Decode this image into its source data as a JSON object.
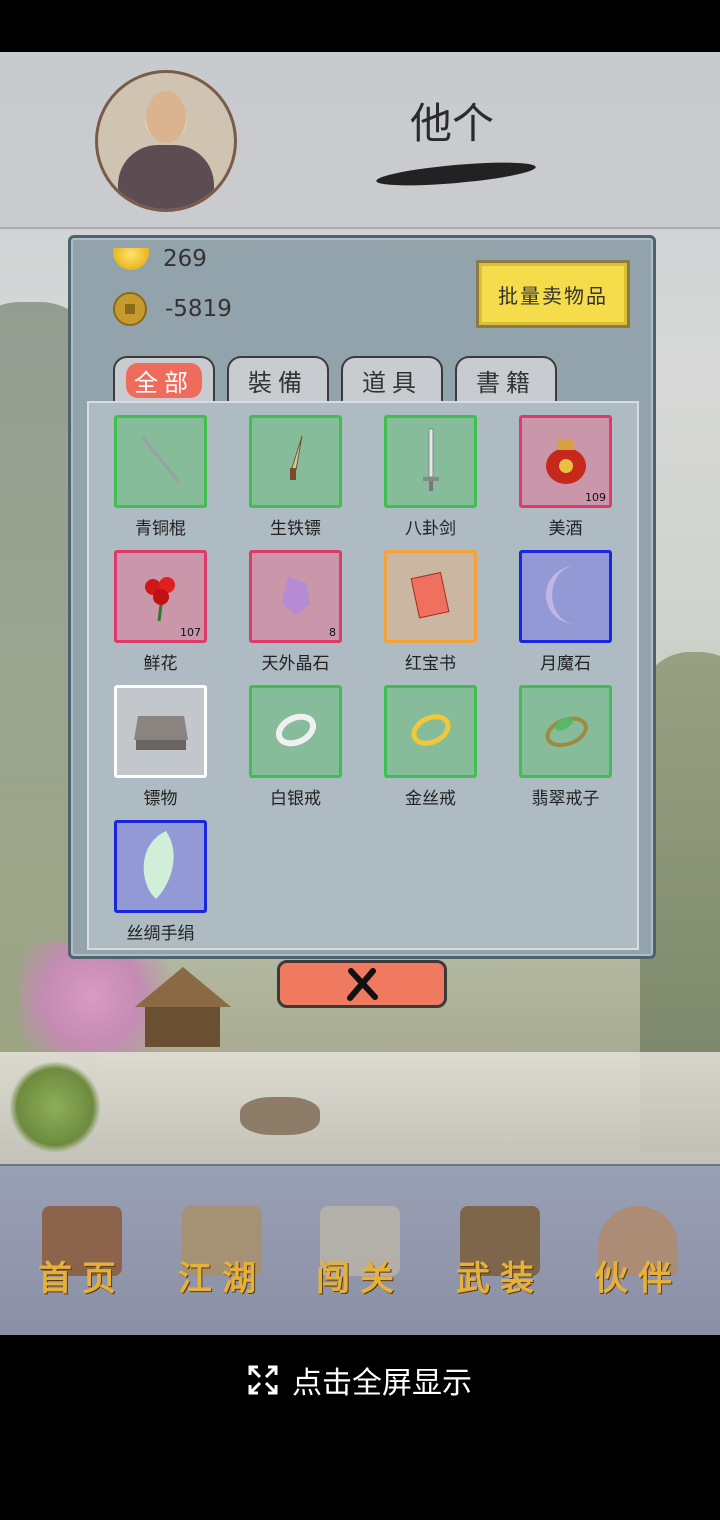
{
  "player": {
    "name": "他个"
  },
  "currency": {
    "gold": "269",
    "coins": "-5819"
  },
  "bulk_sell_label": "批量卖物品",
  "tabs": [
    "全部",
    "裝備",
    "道具",
    "書籍"
  ],
  "items": [
    {
      "name": "青铜棍",
      "count": "",
      "rarity": "green",
      "icon": "staff-icon"
    },
    {
      "name": "生铁镖",
      "count": "",
      "rarity": "green",
      "icon": "dart-icon"
    },
    {
      "name": "八卦剑",
      "count": "",
      "rarity": "green",
      "icon": "sword-icon"
    },
    {
      "name": "美酒",
      "count": "109",
      "rarity": "red",
      "icon": "wine-jar-icon"
    },
    {
      "name": "鲜花",
      "count": "107",
      "rarity": "red",
      "icon": "rose-icon"
    },
    {
      "name": "天外晶石",
      "count": "8",
      "rarity": "red",
      "icon": "crystal-icon"
    },
    {
      "name": "红宝书",
      "count": "",
      "rarity": "orange",
      "icon": "red-book-icon"
    },
    {
      "name": "月魔石",
      "count": "",
      "rarity": "blue",
      "icon": "moon-stone-icon"
    },
    {
      "name": "镖物",
      "count": "",
      "rarity": "white",
      "icon": "cargo-box-icon"
    },
    {
      "name": "白银戒",
      "count": "",
      "rarity": "green",
      "icon": "silver-ring-icon"
    },
    {
      "name": "金丝戒",
      "count": "",
      "rarity": "green",
      "icon": "gold-ring-icon"
    },
    {
      "name": "翡翠戒子",
      "count": "",
      "rarity": "green",
      "icon": "jade-ring-icon"
    },
    {
      "name": "丝绸手绢",
      "count": "",
      "rarity": "blue",
      "icon": "silk-handkerchief-icon"
    }
  ],
  "nav": {
    "home": "首页",
    "jianghu": "江湖",
    "challenge": "闯关",
    "equipment": "武装",
    "partner": "伙伴"
  },
  "fullscreen_label": "点击全屏显示",
  "colors": {
    "green": "#3fbf4f",
    "red": "#e03a6a",
    "orange": "#f3a33a",
    "blue": "#1a25e0",
    "white": "#ffffff",
    "nav_gold": "#e5b13a",
    "close_button": "#f07a60"
  }
}
